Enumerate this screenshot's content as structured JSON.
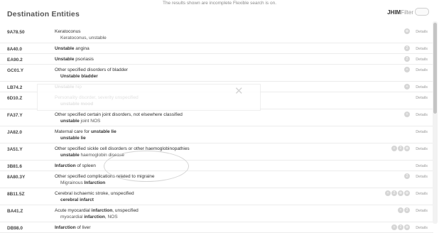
{
  "notice": "The results shown are incomplete Flexible search is on.",
  "header": {
    "title": "Destination Entities",
    "jhim_label": "JHIM",
    "filter_label": "Filter"
  },
  "details_label": "Details",
  "rows": [
    {
      "code": "9A78.50",
      "lines": [
        {
          "parts": [
            {
              "t": "Keratoconus"
            }
          ]
        },
        {
          "parts": [
            {
              "t": "Keratoconus, unstable"
            }
          ]
        }
      ],
      "icons": [
        "⊕"
      ]
    },
    {
      "code": "8A40.0",
      "lines": [
        {
          "parts": [
            {
              "t": "Unstable",
              "b": true
            },
            {
              "t": " angina"
            }
          ]
        }
      ],
      "icons": [
        "2"
      ]
    },
    {
      "code": "EA90.2",
      "lines": [
        {
          "parts": [
            {
              "t": "Unstable",
              "b": true
            },
            {
              "t": " psoriasis"
            }
          ]
        }
      ],
      "icons": [
        "2"
      ]
    },
    {
      "code": "GC01.Y",
      "lines": [
        {
          "parts": [
            {
              "t": "Other specified disorders of bladder"
            }
          ]
        },
        {
          "parts": [
            {
              "t": "Unstable bladder",
              "b": true
            }
          ]
        }
      ],
      "icons": [
        "+"
      ]
    },
    {
      "code": "LB74.2",
      "lines": [
        {
          "parts": [
            {
              "t": "Unstable",
              "b": true
            },
            {
              "t": " hip"
            }
          ]
        }
      ],
      "icons": [
        "+"
      ]
    },
    {
      "code": "6D10.Z",
      "lines": [
        {
          "parts": [
            {
              "t": "Personality disorder, severity unspecified"
            }
          ]
        },
        {
          "parts": [
            {
              "t": "unstable mood",
              "b": true
            }
          ]
        }
      ],
      "icons": []
    },
    {
      "code": "FA37.Y",
      "lines": [
        {
          "parts": [
            {
              "t": "Other specified certain joint disorders, not elsewhere classified"
            }
          ]
        },
        {
          "parts": [
            {
              "t": "unstable",
              "b": true
            },
            {
              "t": " joint NOS"
            }
          ]
        }
      ],
      "icons": [
        "+"
      ]
    },
    {
      "code": "JA82.0",
      "lines": [
        {
          "parts": [
            {
              "t": "Maternal care for "
            },
            {
              "t": "unstable lie",
              "b": true
            }
          ]
        },
        {
          "parts": [
            {
              "t": "unstable lie",
              "b": true
            }
          ]
        }
      ],
      "icons": []
    },
    {
      "code": "3A51.Y",
      "lines": [
        {
          "parts": [
            {
              "t": "Other specified sickle cell disorders or other haemoglobinopathies"
            }
          ]
        },
        {
          "parts": [
            {
              "t": "unstable",
              "b": true
            },
            {
              "t": " haemoglobin disease"
            }
          ]
        }
      ],
      "icons": [
        "+",
        "2",
        "⊗"
      ]
    },
    {
      "code": "3B81.6",
      "lines": [
        {
          "parts": [
            {
              "t": "Infarction",
              "b": true
            },
            {
              "t": " of spleen"
            }
          ]
        }
      ],
      "icons": []
    },
    {
      "code": "8A80.3Y",
      "lines": [
        {
          "parts": [
            {
              "t": "Other specified complications related to migraine"
            }
          ]
        },
        {
          "parts": [
            {
              "t": "Migrainous "
            },
            {
              "t": "Infarction",
              "b": true
            }
          ]
        }
      ],
      "icons": [
        "2"
      ]
    },
    {
      "code": "8B11.5Z",
      "lines": [
        {
          "parts": [
            {
              "t": "Cerebral ischaemic stroke, unspecified"
            }
          ]
        },
        {
          "parts": [
            {
              "t": "cerebral infarct",
              "b": true
            }
          ]
        }
      ],
      "icons": [
        "+",
        "2",
        "⊗",
        "⊕"
      ]
    },
    {
      "code": "BA41.Z",
      "lines": [
        {
          "parts": [
            {
              "t": "Acute myocardial "
            },
            {
              "t": "infarction",
              "b": true
            },
            {
              "t": ", unspecified"
            }
          ]
        },
        {
          "parts": [
            {
              "t": "myocardial "
            },
            {
              "t": "infarction",
              "b": true
            },
            {
              "t": ", NOS"
            }
          ]
        }
      ],
      "icons": [
        "+",
        "2"
      ]
    },
    {
      "code": "DB98.0",
      "lines": [
        {
          "parts": [
            {
              "t": "Infarction",
              "b": true
            },
            {
              "t": " of liver"
            }
          ]
        }
      ],
      "icons": [
        "+",
        "2",
        "⊗"
      ]
    }
  ]
}
